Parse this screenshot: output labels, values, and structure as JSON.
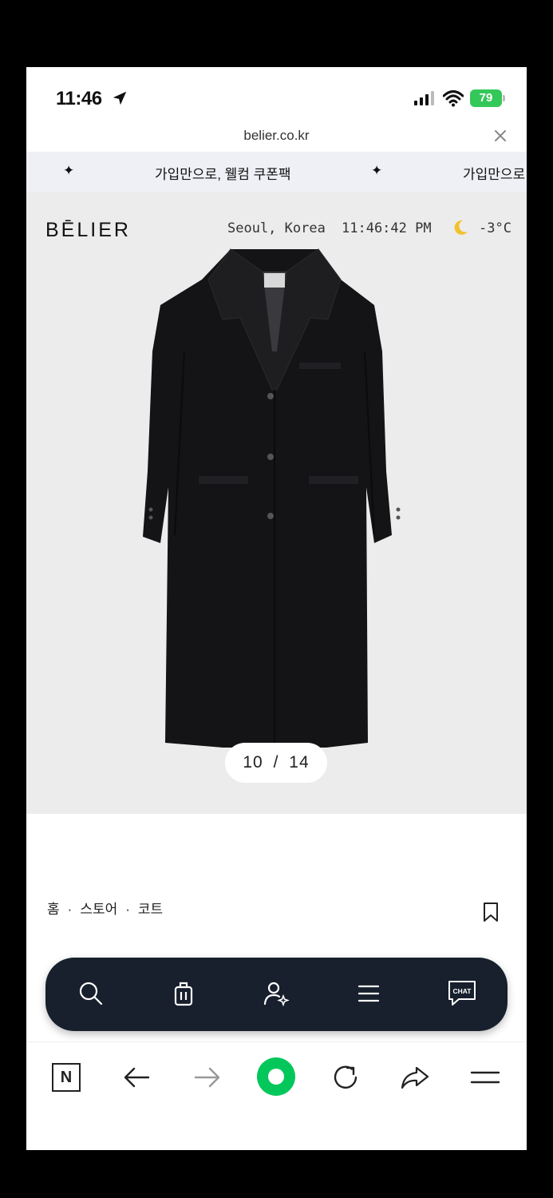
{
  "status_bar": {
    "time": "11:46",
    "battery": "79"
  },
  "url_bar": {
    "url": "belier.co.kr"
  },
  "promo_banner": {
    "star": "✦",
    "text": "가입만으로, 웰컴 쿠폰팩",
    "text_repeat": "가입만으로"
  },
  "header": {
    "brand": "BĒLIER",
    "location": "Seoul, Korea",
    "clock": "11:46:42 PM",
    "temperature": "-3°C"
  },
  "gallery": {
    "current": "10",
    "separator": "/",
    "total": "14"
  },
  "breadcrumb": {
    "items": [
      "홈",
      "스토어",
      "코트"
    ],
    "separator": "·"
  },
  "floating_nav": {
    "chat_label": "CHAT",
    "icons": [
      "search-icon",
      "shopping-bag-icon",
      "user-sparkle-icon",
      "menu-icon",
      "chat-icon"
    ]
  },
  "browser_toolbar": {
    "n_label": "N",
    "icons": [
      "naver-n-icon",
      "back-arrow-icon",
      "forward-arrow-icon",
      "green-dot-icon",
      "reload-icon",
      "share-icon",
      "menu-icon"
    ]
  },
  "colors": {
    "nav_bg": "#17202c",
    "battery_green": "#34c759",
    "naver_green": "#03c75a",
    "banner_bg": "#eef0f5",
    "hero_bg": "#ececec"
  }
}
